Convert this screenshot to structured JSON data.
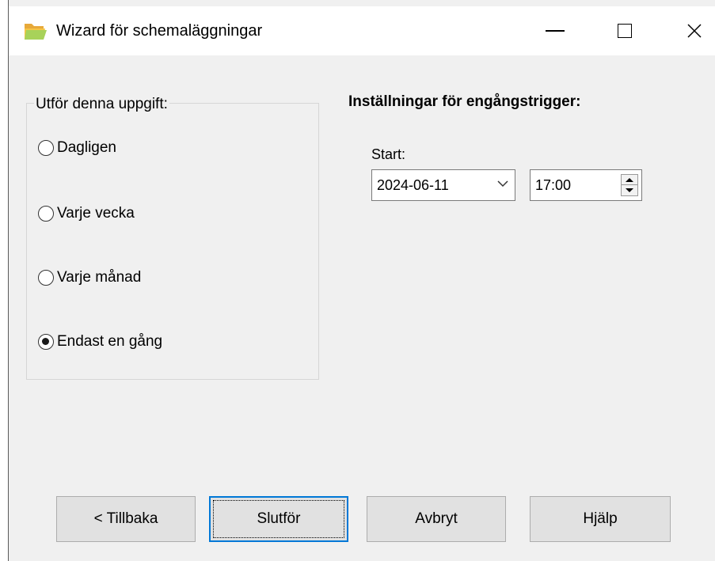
{
  "window": {
    "title": "Wizard för schemaläggningar",
    "icon": "folder-icon",
    "accent": "#0078d7"
  },
  "schedule_group": {
    "legend": "Utför denna uppgift:",
    "options": [
      {
        "label": "Dagligen",
        "checked": false
      },
      {
        "label": "Varje vecka",
        "checked": false
      },
      {
        "label": "Varje månad",
        "checked": false
      },
      {
        "label": "Endast en gång",
        "checked": true
      }
    ]
  },
  "trigger_settings": {
    "heading": "Inställningar för engångstrigger:",
    "start_label": "Start:",
    "date_value": "2024-06-11",
    "time_value": "17:00"
  },
  "buttons": {
    "back": "< Tillbaka",
    "finish": "Slutför",
    "cancel": "Avbryt",
    "help": "Hjälp"
  }
}
